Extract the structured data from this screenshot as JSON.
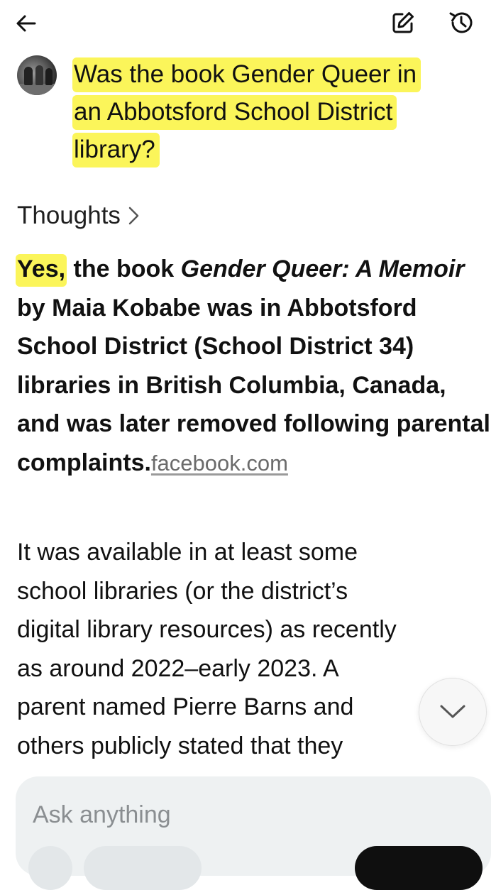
{
  "header": {
    "back_icon": "arrow-left-icon",
    "edit_icon": "edit-square-icon",
    "history_icon": "history-icon"
  },
  "question": {
    "line1": "Was the book Gender Queer in",
    "line2": "an Abbotsford School District",
    "line3": "library?",
    "highlight_color": "#fbf55a"
  },
  "thoughts": {
    "label": "Thoughts",
    "icon": "chevron-right-icon"
  },
  "answer": {
    "yes": "Yes,",
    "text_a": " the book ",
    "title_italic": "Gender Queer: A Memoir",
    "text_b": " by Maia Kobabe was in Abbotsford School District (School District 34) libraries in British Columbia, Canada, and was later removed following parental complaints.",
    "source_link": "facebook.com"
  },
  "paragraph2": {
    "line1": "It was available in at least some",
    "line2": "school libraries (or the district’s",
    "line3": "digital library resources) as recently",
    "line4": "as around 2022–early 2023. A",
    "line5": "parent named Pierre Barns and",
    "line6": "others publicly stated that they"
  },
  "scroll_button": {
    "icon": "chevron-down-icon"
  },
  "composer": {
    "placeholder": "Ask anything"
  }
}
